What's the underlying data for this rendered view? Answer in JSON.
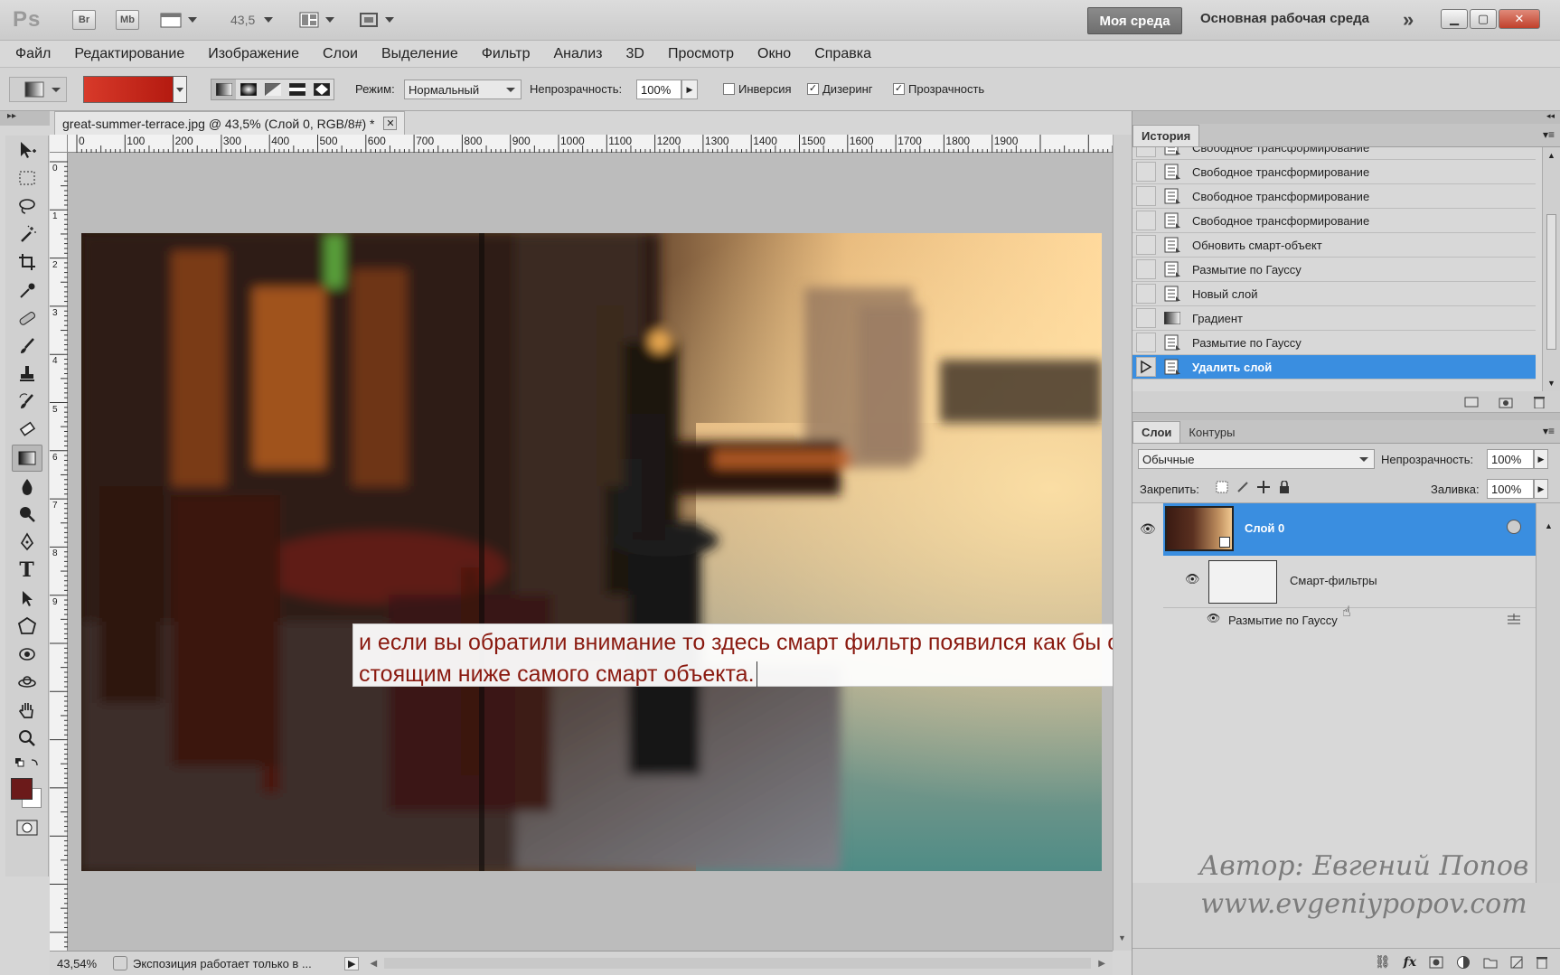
{
  "titlebar": {
    "logo": "Ps",
    "br": "Br",
    "mb": "Mb",
    "zoom": "43,5",
    "workspace_active": "Моя среда",
    "workspace_main": "Основная рабочая среда",
    "more": "»"
  },
  "menu": [
    "Файл",
    "Редактирование",
    "Изображение",
    "Слои",
    "Выделение",
    "Фильтр",
    "Анализ",
    "3D",
    "Просмотр",
    "Окно",
    "Справка"
  ],
  "options": {
    "gradient_color": "#d83a2a",
    "mode_label": "Режим:",
    "mode_value": "Нормальный",
    "opacity_label": "Непрозрачность:",
    "opacity_value": "100%",
    "invert_label": "Инверсия",
    "invert_checked": false,
    "dither_label": "Дизеринг",
    "dither_checked": true,
    "transparency_label": "Прозрачность",
    "transparency_checked": true
  },
  "document": {
    "tab_title": "great-summer-terrace.jpg @ 43,5% (Слой 0, RGB/8#) *",
    "ruler_labels": [
      "0",
      "100",
      "200",
      "300",
      "400",
      "500",
      "600",
      "700",
      "800",
      "900",
      "1000",
      "1100",
      "1200",
      "1300",
      "1400",
      "1500",
      "1600",
      "1700",
      "1800",
      "1900"
    ],
    "ruler_v_labels": [
      "0",
      "1",
      "2",
      "3",
      "4",
      "5",
      "6",
      "7",
      "8",
      "9"
    ],
    "caption_line1": "и если вы обратили внимание то здесь смарт фильтр появился как бы отдельным обьектом",
    "caption_line2": "стоящим ниже самого смарт объекта."
  },
  "status": {
    "zoom": "43,54%",
    "info": "Экспозиция работает только в ..."
  },
  "history": {
    "tab": "История",
    "items": [
      {
        "label": "Свободное трансформирование",
        "icon": "doc-icon"
      },
      {
        "label": "Свободное трансформирование",
        "icon": "doc-icon"
      },
      {
        "label": "Свободное трансформирование",
        "icon": "doc-icon"
      },
      {
        "label": "Свободное трансформирование",
        "icon": "doc-icon"
      },
      {
        "label": "Обновить смарт-объект",
        "icon": "doc-icon"
      },
      {
        "label": "Размытие по Гауссу",
        "icon": "doc-icon"
      },
      {
        "label": "Новый слой",
        "icon": "doc-icon"
      },
      {
        "label": "Градиент",
        "icon": "gradient-icon"
      },
      {
        "label": "Размытие по Гауссу",
        "icon": "doc-icon"
      },
      {
        "label": "Удалить слой",
        "icon": "doc-icon"
      }
    ],
    "selected_index": 9
  },
  "layers": {
    "tab_layers": "Слои",
    "tab_paths": "Контуры",
    "blend_mode": "Обычные",
    "opacity_label": "Непрозрачность:",
    "opacity_value": "100%",
    "lock_label": "Закрепить:",
    "fill_label": "Заливка:",
    "fill_value": "100%",
    "layer_name": "Слой 0",
    "smart_filters": "Смарт-фильтры",
    "filter_name": "Размытие по Гауссу"
  },
  "watermark": {
    "line1": "Автор: Евгений Попов",
    "line2": "www.evgeniypopov.com"
  }
}
